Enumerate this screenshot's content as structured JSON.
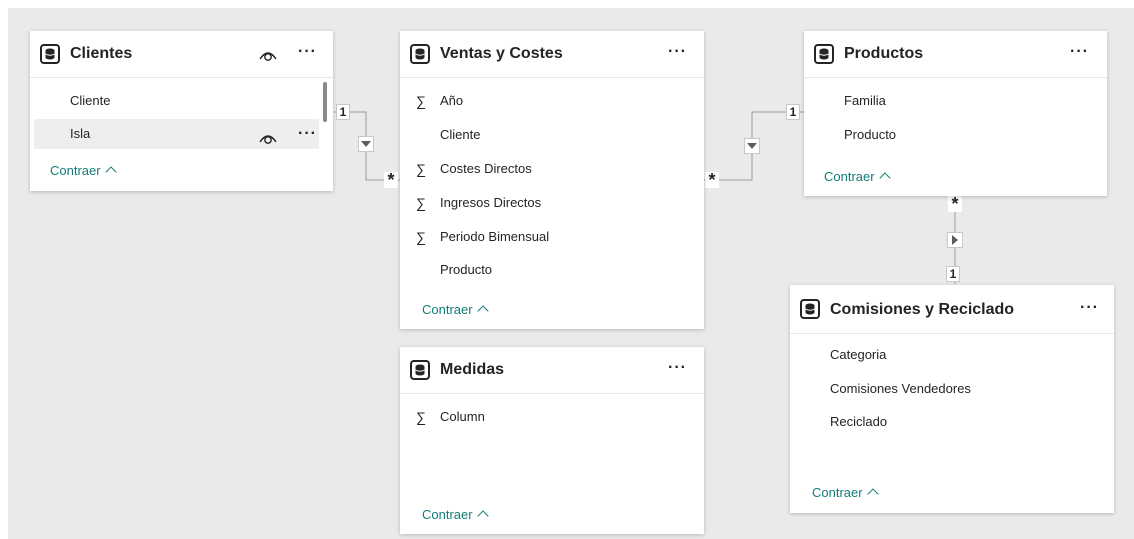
{
  "tables": {
    "clientes": {
      "title": "Clientes",
      "more": "···",
      "fields": [
        "Cliente",
        "Isla"
      ],
      "collapse": "Contraer"
    },
    "ventas": {
      "title": "Ventas y Costes",
      "more": "···",
      "fields": [
        "Año",
        "Cliente",
        "Costes Directos",
        "Ingresos Directos",
        "Periodo Bimensual",
        "Producto"
      ],
      "collapse": "Contraer"
    },
    "productos": {
      "title": "Productos",
      "more": "···",
      "fields": [
        "Familia",
        "Producto"
      ],
      "collapse": "Contraer"
    },
    "medidas": {
      "title": "Medidas",
      "more": "···",
      "fields": [
        "Column"
      ],
      "collapse": "Contraer"
    },
    "comisiones": {
      "title": "Comisiones y Reciclado",
      "more": "···",
      "fields": [
        "Categoria",
        "Comisiones Vendedores",
        "Reciclado"
      ],
      "collapse": "Contraer"
    }
  },
  "sigma": "∑",
  "relationships": {
    "one": "1",
    "many": "*"
  }
}
